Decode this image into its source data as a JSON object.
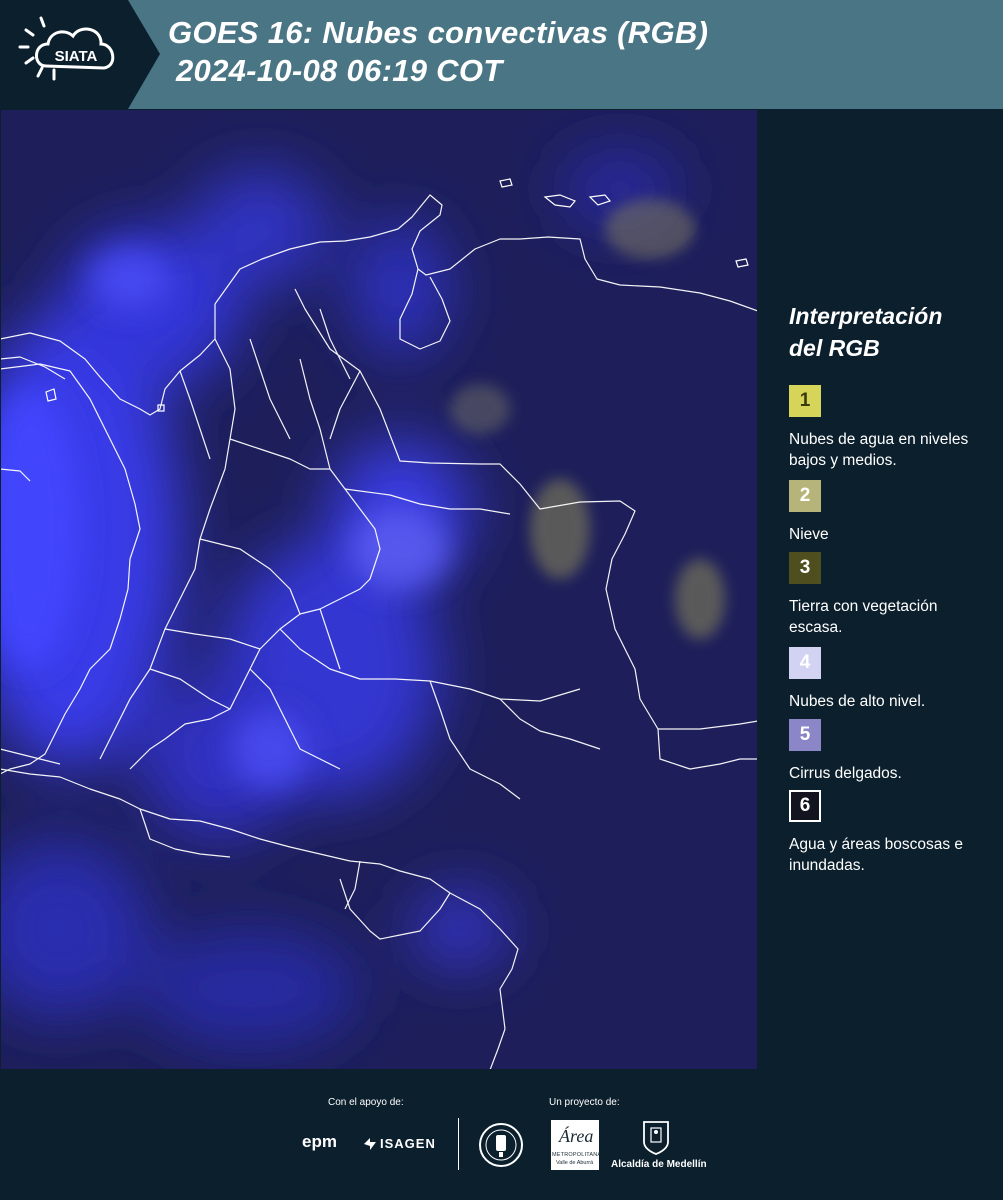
{
  "header": {
    "logo_text": "SIATA",
    "title_line1": "GOES 16: Nubes convectivas (RGB)",
    "title_line2": "2024-10-08 06:19 COT"
  },
  "legend": {
    "title_line1": "Interpretación",
    "title_line2": "del RGB",
    "items": [
      {
        "number": "1",
        "label": "Nubes de agua en niveles bajos y medios.",
        "color": "#d6d55a"
      },
      {
        "number": "2",
        "label": "Nieve",
        "color": "#b7b47a"
      },
      {
        "number": "3",
        "label": "Tierra con vegetación escasa.",
        "color": "#4e4e1f"
      },
      {
        "number": "4",
        "label": "Nubes de alto nivel.",
        "color": "#d2d2f2"
      },
      {
        "number": "5",
        "label": "Cirrus delgados.",
        "color": "#8a86c8"
      },
      {
        "number": "6",
        "label": "Agua y áreas boscosas e inundadas.",
        "color": "#12151f"
      }
    ]
  },
  "footer": {
    "support_label": "Con el apoyo de:",
    "project_label": "Un proyecto de:",
    "sponsor_epm": "epm",
    "sponsor_isagen": "ISAGEN",
    "area_text": "Área",
    "area_sub1": "METROPOLITANA",
    "area_sub2": "Valle de Aburrá",
    "alcaldia": "Alcaldía de Medellín"
  },
  "colors": {
    "header_bg": "#4a7584",
    "page_bg": "#0c1f2c",
    "map_base": "#1e1f5a",
    "cloud_blue": "#3b3df0"
  }
}
